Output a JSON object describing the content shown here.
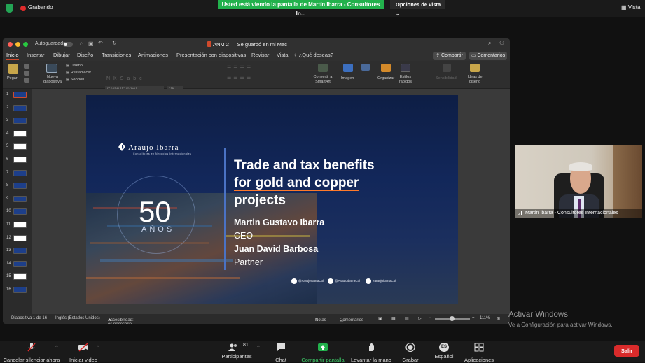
{
  "zoom_top": {
    "recording_label": "Grabando",
    "share_banner": "Usted está viendo la pantalla de Martín Ibarra - Consultores In...",
    "view_options": "Opciones de vista",
    "view_label": "Vista"
  },
  "ppt": {
    "autosave_label": "Autoguardado",
    "doc_title": "ANM 2 — Se guardó en mi Mac",
    "tabs": [
      "Inicio",
      "Insertar",
      "Dibujar",
      "Diseño",
      "Transiciones",
      "Animaciones",
      "Presentación con diapositivas",
      "Revisar",
      "Vista",
      "¿Qué deseas?"
    ],
    "share_button": "Compartir",
    "comments_button": "Comentarios",
    "ribbon": {
      "paste": "Pegar",
      "new_slide": "Nueva diapositiva",
      "layout": "Diseño",
      "reset": "Restablecer",
      "section": "Sección",
      "font_name": "Calibri (Cuerpo)",
      "font_size": "26",
      "convert_smartart": "Convertir a SmartArt",
      "image": "Imagen",
      "arrange": "Organizar",
      "quick_styles": "Estilos rápidos",
      "sensitivity": "Sensibilidad",
      "design_ideas": "Ideas de diseño"
    },
    "thumbnails": [
      "1",
      "2",
      "3",
      "4",
      "5",
      "6",
      "7",
      "8",
      "9",
      "10",
      "11",
      "12",
      "13",
      "14",
      "15",
      "16"
    ],
    "status": {
      "slide_counter": "Diapositiva 1 de 16",
      "language": "Inglés (Estados Unidos)",
      "accessibility": "Accesibilidad: es necesario investigar",
      "notes": "Notas",
      "comments": "Comentarios",
      "zoom": "111%"
    }
  },
  "slide": {
    "logo_name": "Araújo Ibarra",
    "logo_sub": "Consultores en Negocios Internacionales",
    "anniversary_number": "50",
    "anniversary_word": "AÑOS",
    "headline_lines": [
      "Trade and tax benefits",
      "for gold and copper",
      "projects"
    ],
    "speaker1_name": "Martin Gustavo Ibarra",
    "speaker1_role": "CEO",
    "speaker2_name": "Juan David Barbosa",
    "speaker2_role": "Partner",
    "social": [
      "@AraujoIbarraCol",
      "@AraujoIbarraCol",
      "#araujoibarraCol"
    ]
  },
  "video": {
    "participant_name": "Martin Ibarra - Consultores Internacionales"
  },
  "watermark": {
    "line1": "Activar Windows",
    "line2": "Ve a Configuración para activar Windows."
  },
  "zoom_bottom": {
    "mute": "Cancelar silenciar ahora",
    "video": "Iniciar video",
    "participants": "Participantes",
    "participants_count": "81",
    "chat": "Chat",
    "share": "Compartir pantalla",
    "raise_hand": "Levantar la mano",
    "record": "Grabar",
    "language": "Español",
    "language_badge": "ES",
    "apps": "Aplicaciones",
    "leave": "Salir"
  },
  "colors": {
    "share_banner": "#22b14c",
    "leave": "#d92b2b",
    "accent_underline": "#ff7a2a",
    "slide_bg": "#12275a"
  }
}
